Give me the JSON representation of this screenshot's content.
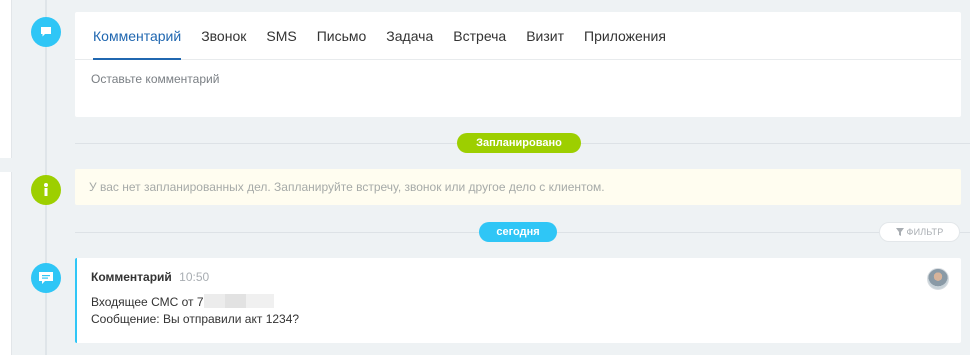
{
  "editor": {
    "tabs": [
      {
        "label": "Комментарий",
        "active": true
      },
      {
        "label": "Звонок"
      },
      {
        "label": "SMS"
      },
      {
        "label": "Письмо"
      },
      {
        "label": "Задача"
      },
      {
        "label": "Встреча"
      },
      {
        "label": "Визит"
      },
      {
        "label": "Приложения"
      }
    ],
    "placeholder": "Оставьте комментарий"
  },
  "sections": {
    "planned_label": "Запланировано",
    "today_label": "сегодня"
  },
  "notice": {
    "text": "У вас нет запланированных дел. Запланируйте встречу, звонок или другое дело с клиентом."
  },
  "filter": {
    "label": "ФИЛЬТР"
  },
  "comment": {
    "title": "Комментарий",
    "time": "10:50",
    "line1_prefix": "Входящее СМС от 7",
    "line2": "Сообщение: Вы отправили акт 1234?"
  },
  "colors": {
    "accent_blue": "#2fc6f6",
    "accent_green": "#9dcf00",
    "tab_active": "#2067b0"
  }
}
